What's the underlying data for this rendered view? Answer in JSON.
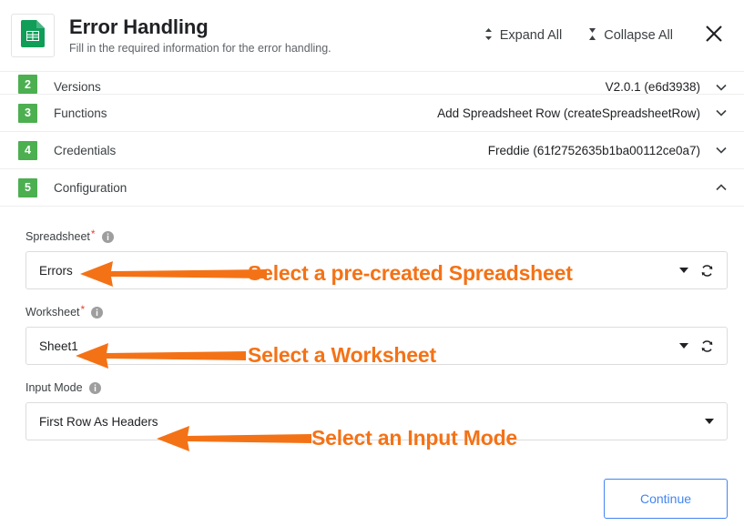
{
  "header": {
    "icon": "google-sheets-icon",
    "title": "Error Handling",
    "subtitle": "Fill in the required information for the error handling.",
    "expand_all_label": "Expand All",
    "collapse_all_label": "Collapse All",
    "expand_icon": "expand-chevrons-icon",
    "collapse_icon": "collapse-chevrons-icon",
    "close_icon": "close-icon"
  },
  "steps": [
    {
      "number": "2",
      "label": "Versions",
      "value": "V2.0.1 (e6d3938)",
      "expanded": false,
      "chevron": "chevron-down-icon"
    },
    {
      "number": "3",
      "label": "Functions",
      "value": "Add Spreadsheet Row (createSpreadsheetRow)",
      "expanded": false,
      "chevron": "chevron-down-icon"
    },
    {
      "number": "4",
      "label": "Credentials",
      "value": "Freddie (61f2752635b1ba00112ce0a7)",
      "expanded": false,
      "chevron": "chevron-down-icon"
    },
    {
      "number": "5",
      "label": "Configuration",
      "value": "",
      "expanded": true,
      "chevron": "chevron-up-icon"
    }
  ],
  "configuration": {
    "fields": [
      {
        "label": "Spreadsheet",
        "required": true,
        "value": "Errors",
        "has_refresh": true,
        "info_icon": "info-icon",
        "caret_icon": "chevron-down-icon",
        "refresh_icon": "refresh-icon"
      },
      {
        "label": "Worksheet",
        "required": true,
        "value": "Sheet1",
        "has_refresh": true,
        "info_icon": "info-icon",
        "caret_icon": "chevron-down-icon",
        "refresh_icon": "refresh-icon"
      },
      {
        "label": "Input Mode",
        "required": false,
        "value": "First Row As Headers",
        "has_refresh": false,
        "info_icon": "info-icon",
        "caret_icon": "chevron-down-icon",
        "refresh_icon": ""
      }
    ]
  },
  "annotations": [
    {
      "text": "Select a pre-created Spreadsheet"
    },
    {
      "text": "Select a Worksheet"
    },
    {
      "text": "Select an Input Mode"
    }
  ],
  "footer": {
    "continue_label": "Continue"
  },
  "colors": {
    "accent_green": "#4CAF50",
    "annotation_orange": "#F47216",
    "button_blue": "#4285f4",
    "required_red": "#ea4335"
  }
}
